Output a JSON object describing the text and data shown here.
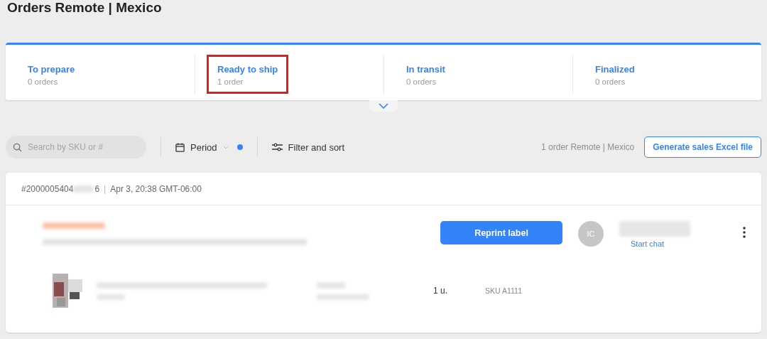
{
  "page": {
    "title": "Orders Remote | Mexico"
  },
  "tabs": [
    {
      "label": "To prepare",
      "count": "0 orders",
      "highlighted": false
    },
    {
      "label": "Ready to ship",
      "count": "1 order",
      "highlighted": true
    },
    {
      "label": "In transit",
      "count": "0 orders",
      "highlighted": false
    },
    {
      "label": "Finalized",
      "count": "0 orders",
      "highlighted": false
    }
  ],
  "toolbar": {
    "search": {
      "placeholder": "Search by SKU or #"
    },
    "period": {
      "label": "Period",
      "active": true
    },
    "filter": {
      "label": "Filter and sort"
    },
    "summary": "1 order Remote | Mexico",
    "export_button": "Generate sales Excel file"
  },
  "order": {
    "number": "#2000005404",
    "number_redacted": true,
    "number_end": "6",
    "separator": "|",
    "date": "Apr 3, 20:38 GMT-06:00",
    "status_redacted": true,
    "button": "Reprint label",
    "buyer": {
      "initials": "IC",
      "name_redacted": true,
      "chat_link": "Start chat"
    },
    "item": {
      "title_redacted": true,
      "price_redacted": true,
      "quantity": "1 u.",
      "sku": "SKU A1111"
    }
  }
}
